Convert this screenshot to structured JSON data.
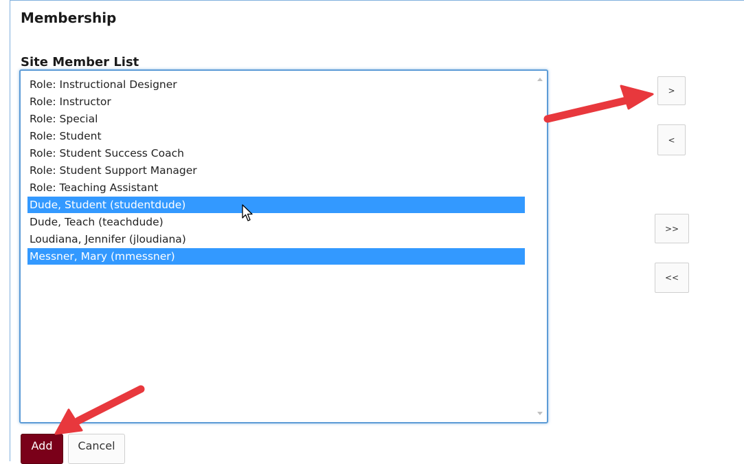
{
  "page": {
    "title": "Membership",
    "list_label": "Site Member List"
  },
  "member_list": {
    "options": [
      {
        "label": "Role: Instructional Designer",
        "selected": false
      },
      {
        "label": "Role: Instructor",
        "selected": false
      },
      {
        "label": "Role: Special",
        "selected": false
      },
      {
        "label": "Role: Student",
        "selected": false
      },
      {
        "label": "Role: Student Success Coach",
        "selected": false
      },
      {
        "label": "Role: Student Support Manager",
        "selected": false
      },
      {
        "label": "Role: Teaching Assistant",
        "selected": false
      },
      {
        "label": "Dude, Student (studentdude)",
        "selected": true
      },
      {
        "label": "Dude, Teach (teachdude)",
        "selected": false
      },
      {
        "label": "Loudiana, Jennifer (jloudiana)",
        "selected": false
      },
      {
        "label": "Messner, Mary (mmessner)",
        "selected": true
      }
    ]
  },
  "move_buttons": {
    "move_right": ">",
    "move_left": "<",
    "move_all_right": ">>",
    "move_all_left": "<<"
  },
  "actions": {
    "add_label": "Add",
    "cancel_label": "Cancel"
  },
  "colors": {
    "selection": "#3399ff",
    "primary_button": "#7a0019",
    "annotation_arrow": "#e8383d"
  },
  "icons": {
    "cursor": "mouse-pointer-icon",
    "annotation": "red-arrow-icon"
  }
}
